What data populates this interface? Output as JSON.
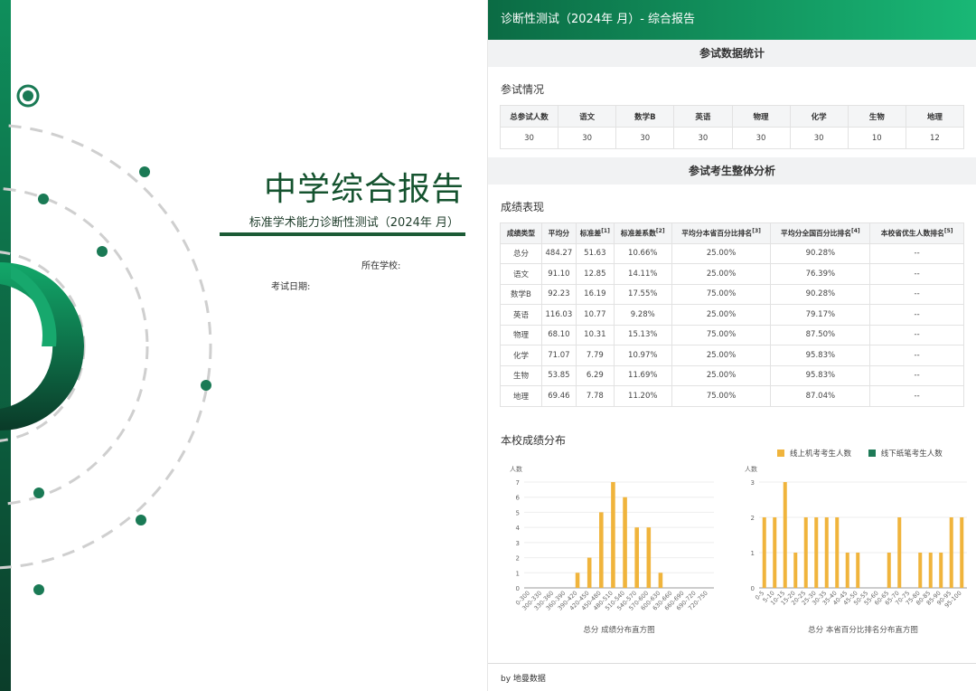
{
  "cover": {
    "title": "中学综合报告",
    "subtitle": "标准学术能力诊断性测试（2024年  月）",
    "school_label": "所在学校:",
    "date_label": "考试日期:"
  },
  "header": {
    "title": "诊断性测试（2024年  月）- 综合报告"
  },
  "section1": {
    "title": "参试数据统计",
    "subtitle": "参试情况",
    "headers": [
      "总参试人数",
      "语文",
      "数学B",
      "英语",
      "物理",
      "化学",
      "生物",
      "地理"
    ],
    "values": [
      "30",
      "30",
      "30",
      "30",
      "30",
      "30",
      "10",
      "12"
    ]
  },
  "section2": {
    "title": "参试考生整体分析",
    "subtitle": "成绩表现",
    "headers": [
      "成绩类型",
      "平均分",
      "标准差",
      "标准差系数",
      "平均分本省百分比排名",
      "平均分全国百分比排名",
      "本校省优生人数排名"
    ],
    "header_sups": [
      "",
      "",
      "[1]",
      "[2]",
      "[3]",
      "[4]",
      "[5]"
    ],
    "rows": [
      [
        "总分",
        "484.27",
        "51.63",
        "10.66%",
        "25.00%",
        "90.28%",
        "--"
      ],
      [
        "语文",
        "91.10",
        "12.85",
        "14.11%",
        "25.00%",
        "76.39%",
        "--"
      ],
      [
        "数学B",
        "92.23",
        "16.19",
        "17.55%",
        "75.00%",
        "90.28%",
        "--"
      ],
      [
        "英语",
        "116.03",
        "10.77",
        "9.28%",
        "25.00%",
        "79.17%",
        "--"
      ],
      [
        "物理",
        "68.10",
        "10.31",
        "15.13%",
        "75.00%",
        "87.50%",
        "--"
      ],
      [
        "化学",
        "71.07",
        "7.79",
        "10.97%",
        "25.00%",
        "95.83%",
        "--"
      ],
      [
        "生物",
        "53.85",
        "6.29",
        "11.69%",
        "25.00%",
        "95.83%",
        "--"
      ],
      [
        "地理",
        "69.46",
        "7.78",
        "11.20%",
        "75.00%",
        "87.04%",
        "--"
      ]
    ]
  },
  "distribution": {
    "title": "本校成绩分布",
    "legend": [
      {
        "label": "线上机考考生人数",
        "color": "#f0b43c"
      },
      {
        "label": "线下纸笔考生人数",
        "color": "#1e7a57"
      }
    ]
  },
  "chart_data": [
    {
      "type": "bar",
      "title": "总分 成绩分布直方图",
      "ylabel": "人数",
      "ylim": [
        0,
        7
      ],
      "yticks": [
        0,
        1,
        2,
        3,
        4,
        5,
        6,
        7
      ],
      "categories": [
        "0-300",
        "300-330",
        "330-360",
        "360-390",
        "390-420",
        "420-450",
        "450-480",
        "480-510",
        "510-540",
        "540-570",
        "570-600",
        "600-630",
        "630-660",
        "660-690",
        "690-720",
        "720-750"
      ],
      "series": [
        {
          "name": "线上机考考生人数",
          "values": [
            0,
            0,
            0,
            0,
            1,
            2,
            5,
            7,
            6,
            4,
            4,
            1,
            0,
            0,
            0,
            0
          ]
        }
      ]
    },
    {
      "type": "bar",
      "title": "总分 本省百分比排名分布直方图",
      "ylabel": "人数",
      "ylim": [
        0,
        3
      ],
      "yticks": [
        0,
        1,
        2,
        3
      ],
      "categories": [
        "0-5",
        "5-10",
        "10-15",
        "15-20",
        "20-25",
        "25-30",
        "30-35",
        "35-40",
        "40-45",
        "45-50",
        "50-55",
        "55-60",
        "60-65",
        "65-70",
        "70-75",
        "75-80",
        "80-85",
        "85-90",
        "90-95",
        "95-100"
      ],
      "series": [
        {
          "name": "线上机考考生人数",
          "values": [
            2,
            2,
            3,
            1,
            2,
            2,
            2,
            2,
            1,
            1,
            0,
            0,
            1,
            2,
            0,
            1,
            1,
            1,
            2,
            2,
            2
          ]
        }
      ]
    }
  ],
  "footer": {
    "text": "by 地曼数据"
  }
}
